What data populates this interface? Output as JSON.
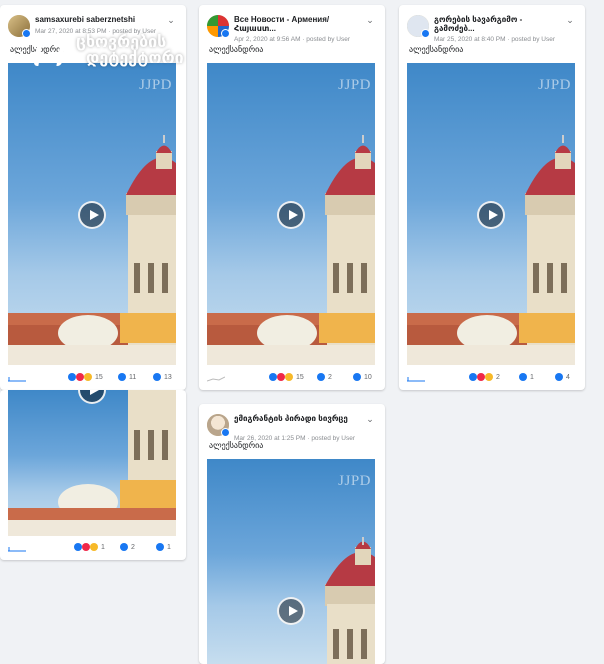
{
  "posts": [
    {
      "page_name": "samsaxurebi saberznetshi",
      "meta": "Mar 27, 2020 at 8:53 PM · posted by User",
      "caption": "ალექსანდრია",
      "watermark": "JJPD",
      "stats": {
        "reactions": "15",
        "comments": "11",
        "shares": "13"
      }
    },
    {
      "page_name": "Все Новости - Армения/ Հայաստ...",
      "meta": "Apr 2, 2020 at 9:56 AM · posted by User",
      "caption": "ალექსანდრია",
      "watermark": "JJPD",
      "stats": {
        "reactions": "15",
        "comments": "2",
        "shares": "10"
      }
    },
    {
      "page_name": "გორების სავარგიმო - გამოძებ...",
      "meta": "Mar 25, 2020 at 8:40 PM · posted by User",
      "caption": "ალექსანდრია",
      "watermark": "JJPD",
      "stats": {
        "reactions": "2",
        "comments": "1",
        "shares": "4"
      }
    },
    {
      "page_name": "",
      "meta": "",
      "caption": "",
      "watermark": "",
      "stats": {
        "reactions": "1",
        "comments": "2",
        "shares": "1"
      }
    },
    {
      "page_name": "ემიგრანტის პირადი სივრცე",
      "meta": "Mar 26, 2020 at 1:25 PM · posted by User",
      "caption": "ალექსანდრია",
      "watermark": "JJPD",
      "stats": {
        "reactions": "",
        "comments": "",
        "shares": ""
      }
    }
  ],
  "overlay_logo": {
    "line1": "ცხოვრების",
    "line2": "დეტექტორი"
  },
  "icons": {
    "menu": "chevron-down-icon",
    "play": "play-icon",
    "globe": "globe-icon",
    "reactions": "reaction-icons",
    "comments": "comment-icon",
    "shares": "share-icon"
  },
  "colors": {
    "accent": "#1877f2",
    "love": "#f02849",
    "haha": "#f7b928"
  }
}
